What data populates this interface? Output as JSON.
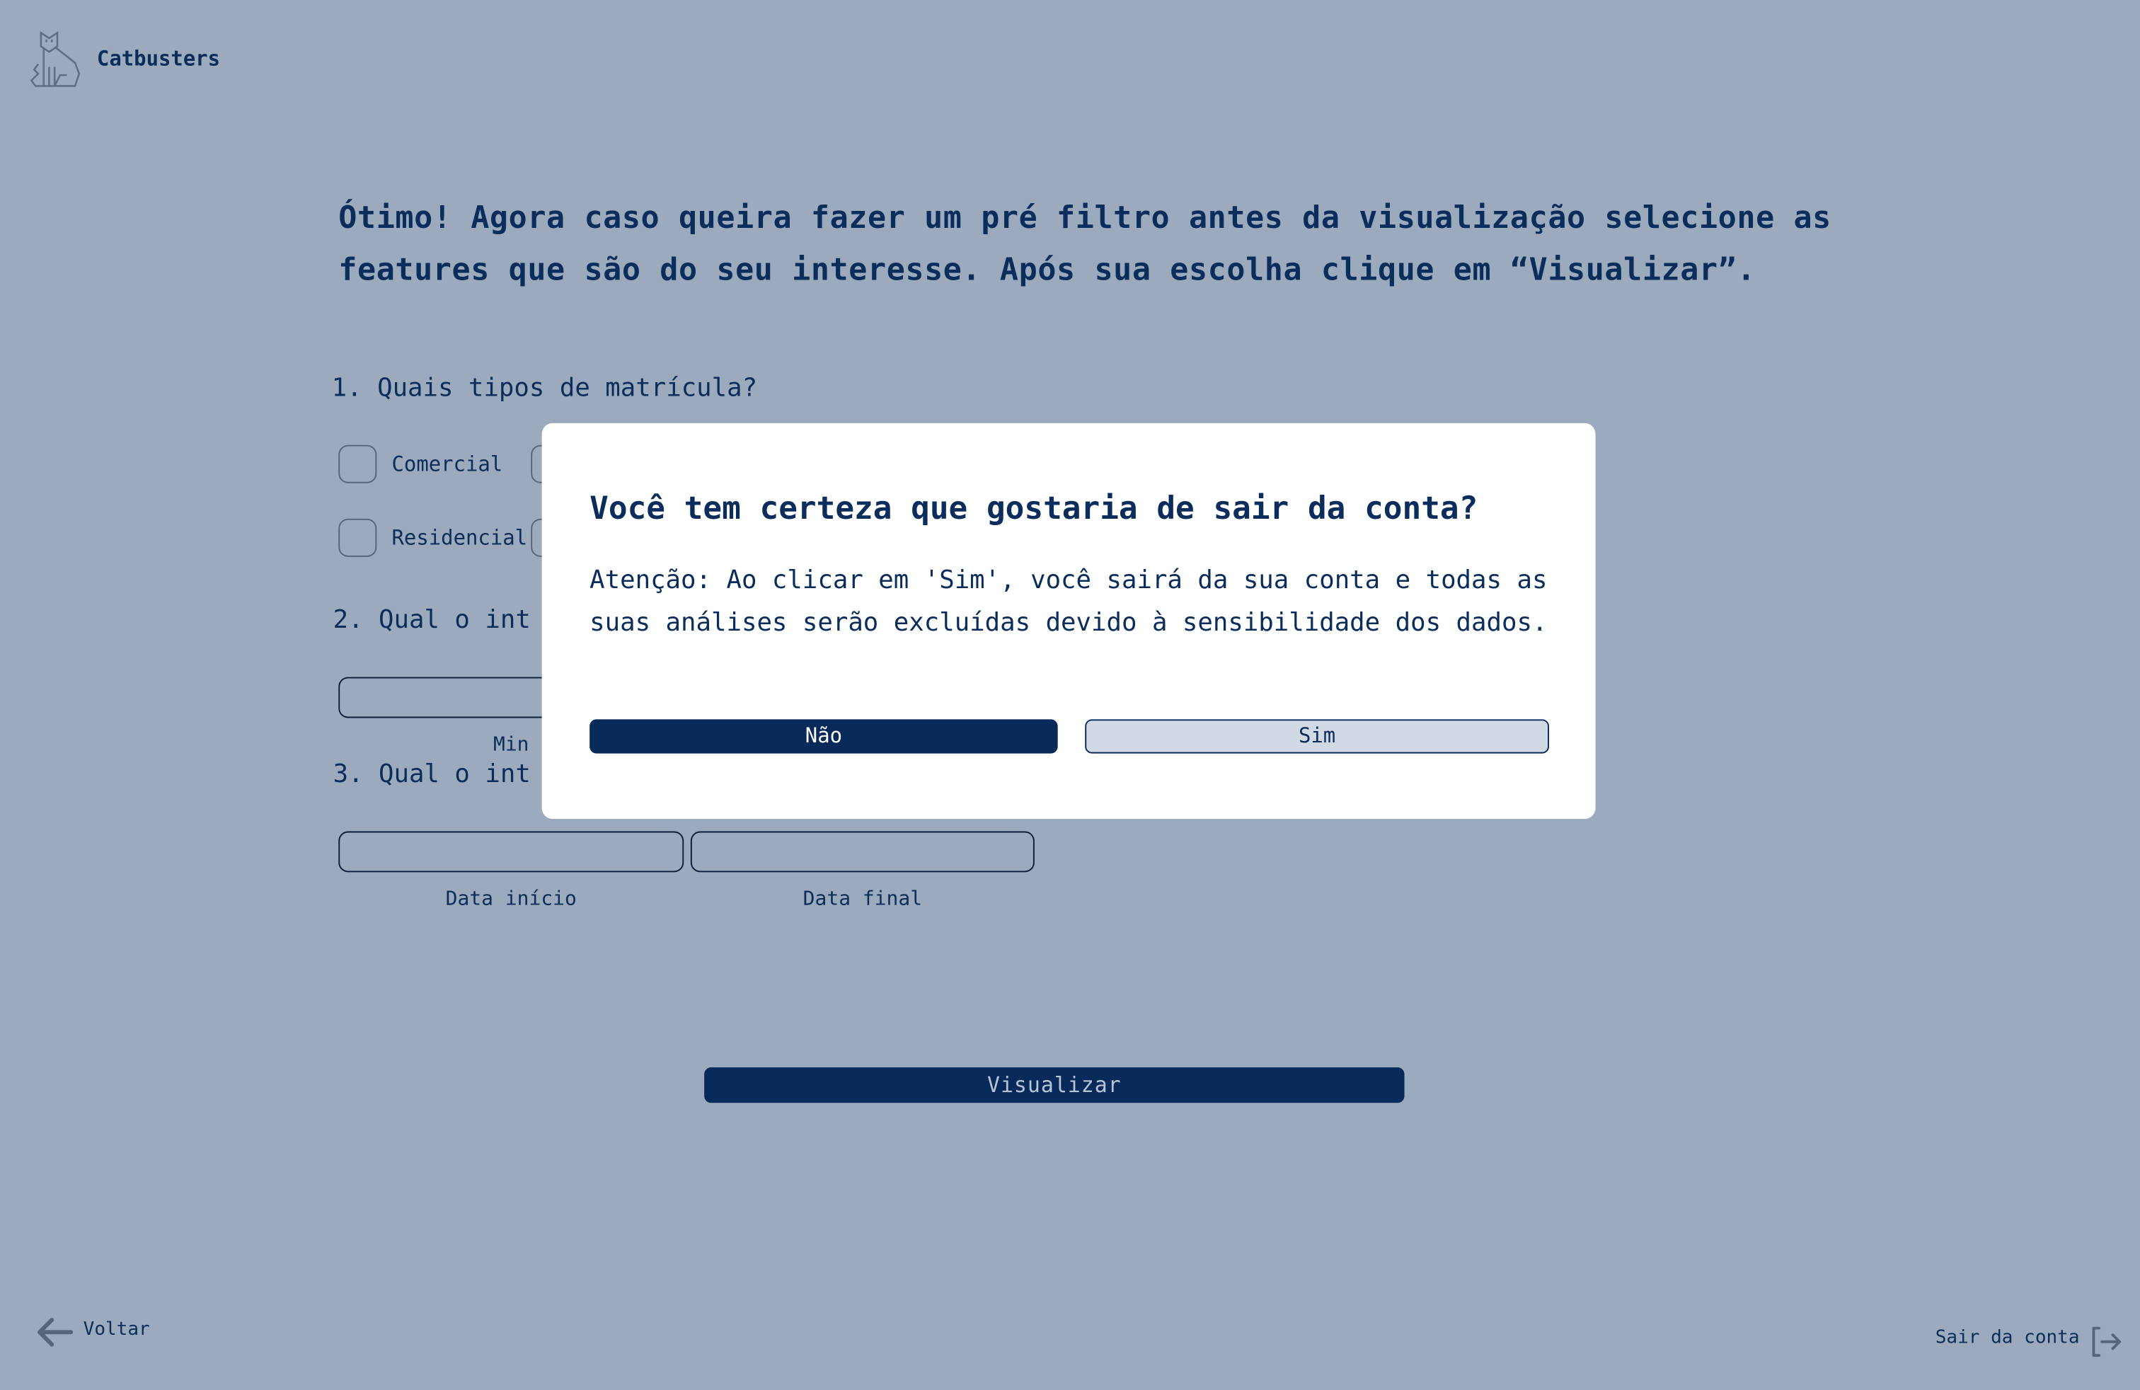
{
  "header": {
    "brand": "Catbusters"
  },
  "main": {
    "intro": "Ótimo! Agora caso queira fazer um pré filtro antes da visualização selecione as features que são do seu interesse. Após sua escolha clique em “Visualizar”.",
    "q1": {
      "label": "1. Quais tipos de matrícula?",
      "options": [
        "Comercial",
        "Residencial"
      ]
    },
    "q2": {
      "label": "2. Qual o int",
      "min_label": "Min"
    },
    "q3": {
      "label": "3. Qual o int",
      "start_label": "Data início",
      "end_label": "Data final"
    },
    "visualize_label": "Visualizar"
  },
  "footer": {
    "back_label": "Voltar",
    "logout_label": "Sair da conta"
  },
  "modal": {
    "title": "Você tem certeza que gostaria de sair da conta?",
    "body": "Atenção: Ao clicar em 'Sim', você sairá da sua conta e todas as suas análises serão excluídas devido à sensibilidade dos dados.",
    "no_label": "Não",
    "yes_label": "Sim"
  },
  "colors": {
    "background": "#9caabd",
    "primary": "#072a5a",
    "text": "#0b2d5b"
  }
}
